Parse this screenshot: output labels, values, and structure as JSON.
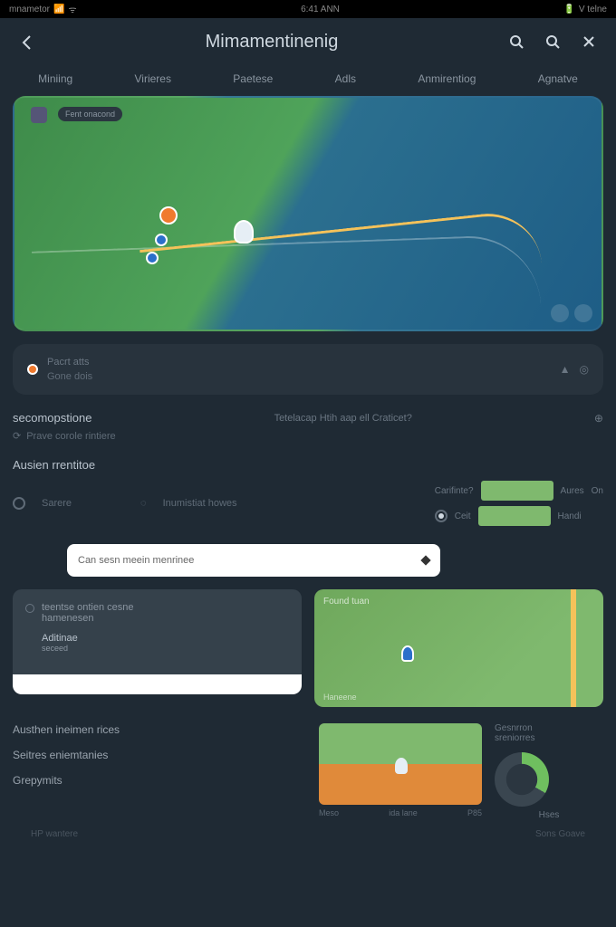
{
  "status": {
    "carrier": "mnametor",
    "time": "6:41 ANN",
    "bat": "V telne"
  },
  "header": {
    "title": "Mimamentinenig"
  },
  "tabs": [
    "Miniing",
    "Virieres",
    "Paetese",
    "Adls",
    "Anmirentiog",
    "Agnatve"
  ],
  "map_badge": "Fent onacond",
  "panel": {
    "title": "Pacrt atts",
    "sub": "Gone dois"
  },
  "sec1": {
    "title": "secomopstione",
    "hint": "Tetelacap Htih aap ell Craticet?",
    "sub": "Prave corole rintiere"
  },
  "controls": {
    "title": "Ausien rrentitoe",
    "r1": "Sarere",
    "r2": "Inumistiat howes",
    "right_top": "Carifinte?",
    "right_a": "Aures",
    "right_b": "On",
    "right_c": "Ceit",
    "right_d": "Handi"
  },
  "search": {
    "placeholder": "Can sesn meein menrinee"
  },
  "card_l": {
    "line1a": "teentse ontien cesne",
    "line1b": "hamenesen",
    "line2a": "Aditinae",
    "line2b": "seceed"
  },
  "card_r": {
    "lbl": "Found tuan",
    "bl": "Haneene"
  },
  "bottom_l": {
    "a": "Austhen ineimen rices",
    "b": "Seitres eniemtanies",
    "c": "Grepymits"
  },
  "stack_x": {
    "a": "Meso",
    "b": "ida lane",
    "c": "P85"
  },
  "bottom_r": {
    "a": "Gesnrron",
    "b": "sreniorres",
    "c": "Hses"
  },
  "footer": {
    "l": "HP wantere",
    "r": "Sons Goave"
  },
  "chart_data": {
    "type": "bar",
    "categories": [
      "Meso",
      "ida lane",
      "P85"
    ],
    "series": [
      {
        "name": "green",
        "values": [
          50,
          50,
          50
        ]
      },
      {
        "name": "orange",
        "values": [
          50,
          50,
          50
        ]
      }
    ],
    "title": "",
    "xlabel": "",
    "ylabel": "",
    "ylim": [
      0,
      100
    ]
  }
}
